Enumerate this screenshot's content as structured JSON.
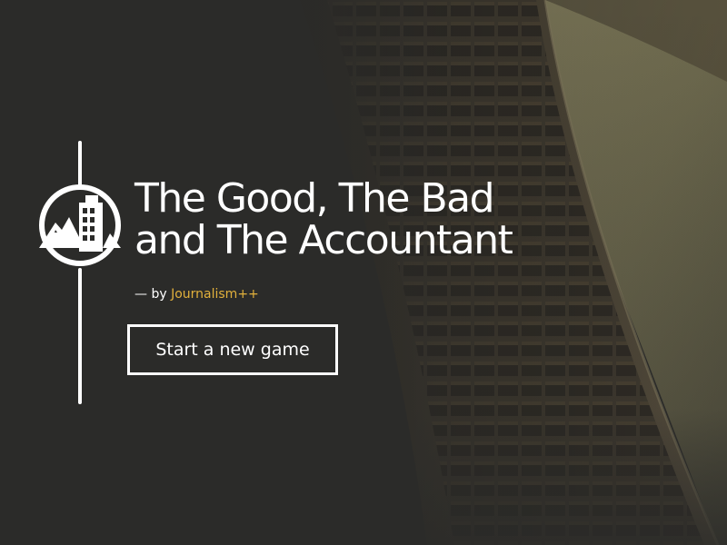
{
  "title": {
    "line1": "The Good, The Bad",
    "line2": "and The Accountant"
  },
  "byline": {
    "prefix": "— by",
    "author": "Journalism++"
  },
  "actions": {
    "start_label": "Start a new game"
  },
  "logo": {
    "icon": "mountain-building-icon"
  },
  "colors": {
    "background": "#2b2b29",
    "text": "#ffffff",
    "accent": "#e2b13c"
  }
}
